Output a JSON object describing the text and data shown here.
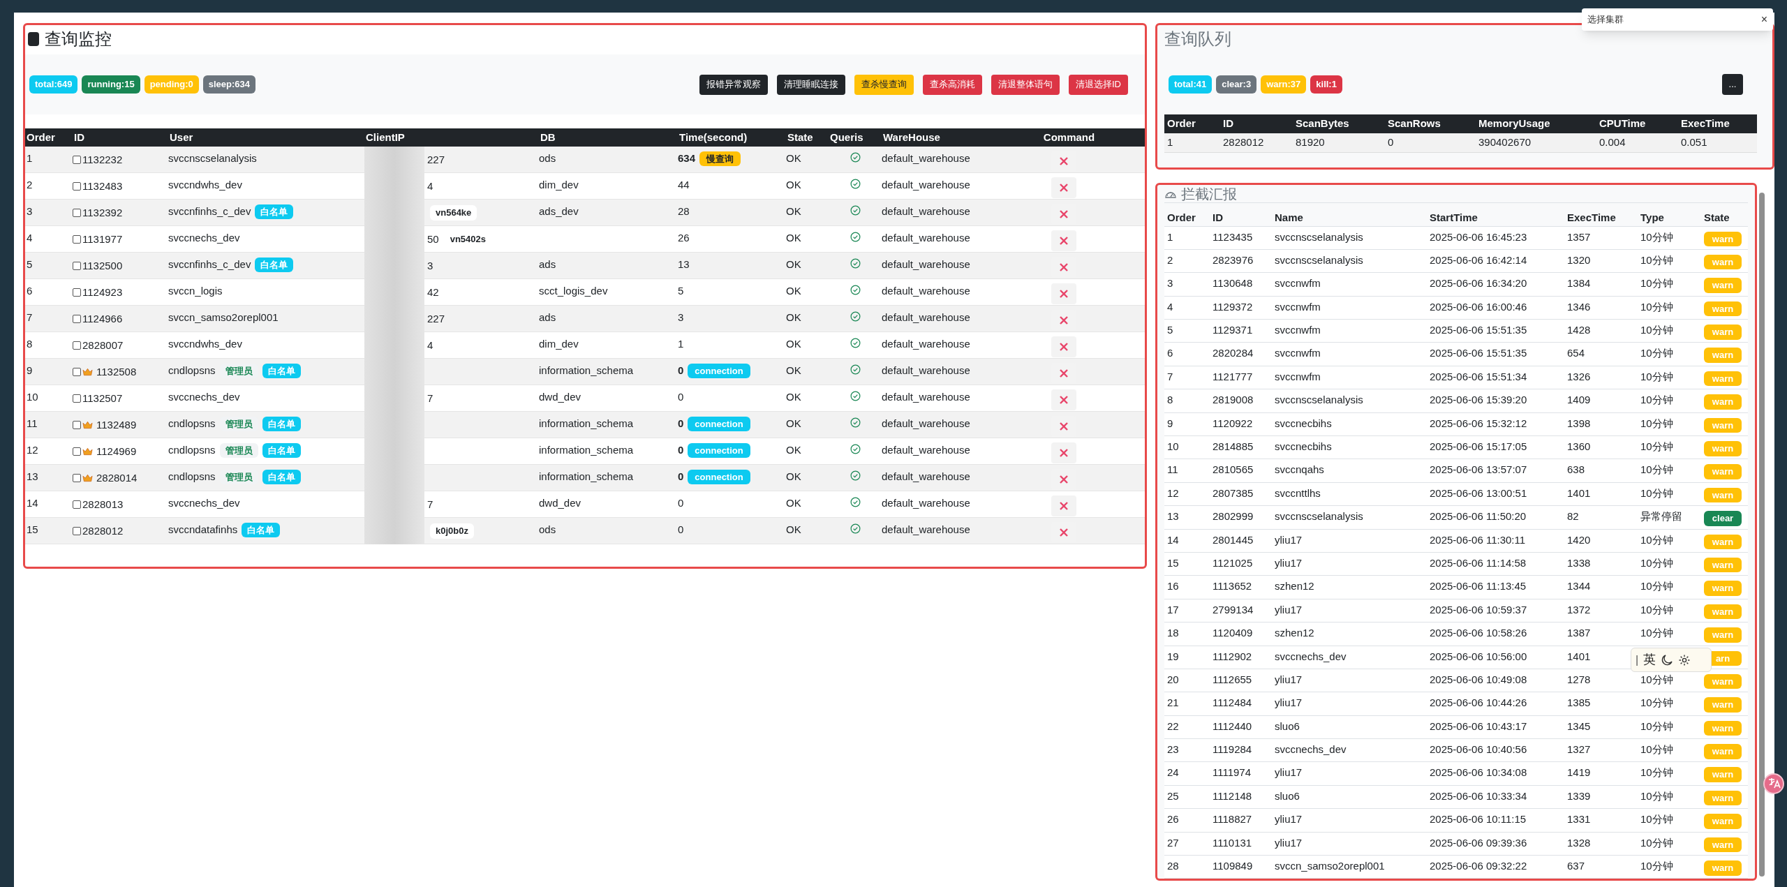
{
  "monitor": {
    "title": "查询监控",
    "counters": [
      {
        "label": "total:649",
        "color": "#0dcaf0"
      },
      {
        "label": "running:15",
        "color": "#198754"
      },
      {
        "label": "pending:0",
        "color": "#ffc107"
      },
      {
        "label": "sleep:634",
        "color": "#6c757d"
      }
    ],
    "actions": [
      {
        "label": "报错异常观察",
        "kind": "dark"
      },
      {
        "label": "清理睡眠连接",
        "kind": "dark"
      },
      {
        "label": "查杀慢查询",
        "kind": "warning"
      },
      {
        "label": "查杀高消耗",
        "kind": "danger"
      },
      {
        "label": "清退整体语句",
        "kind": "danger"
      },
      {
        "label": "清退选择ID",
        "kind": "danger"
      }
    ],
    "columns": [
      "Order",
      "ID",
      "User",
      "ClientIP",
      "DB",
      "Time(second)",
      "State",
      "Queris",
      "WareHouse",
      "Command"
    ],
    "rows": [
      {
        "order": "1",
        "id": "1132232",
        "checked": false,
        "admin": false,
        "user": "svccnscselanalysis",
        "tags": [],
        "ip_tail": "227",
        "db": "ods",
        "time": "634",
        "time_tag": {
          "kind": "slow",
          "label": "慢查询"
        },
        "state": "OK",
        "warehouse": "default_warehouse"
      },
      {
        "order": "2",
        "id": "1132483",
        "checked": false,
        "admin": false,
        "user": "svccndwhs_dev",
        "tags": [],
        "ip_tail": "4",
        "db": "dim_dev",
        "time": "44",
        "state": "OK",
        "warehouse": "default_warehouse"
      },
      {
        "order": "3",
        "id": "1132392",
        "checked": false,
        "admin": false,
        "user": "svccnfinhs_c_dev",
        "tags": [
          {
            "kind": "whitelist",
            "label": "白名单"
          }
        ],
        "host": "vn564ke",
        "db": "ads_dev",
        "time": "28",
        "state": "OK",
        "warehouse": "default_warehouse"
      },
      {
        "order": "4",
        "id": "1131977",
        "checked": false,
        "admin": false,
        "user": "svccnechs_dev",
        "tags": [],
        "ip_tail": "50",
        "host": "vn5402s",
        "time": "26",
        "state": "OK",
        "warehouse": "default_warehouse"
      },
      {
        "order": "5",
        "id": "1132500",
        "checked": false,
        "admin": false,
        "user": "svccnfinhs_c_dev",
        "tags": [
          {
            "kind": "whitelist",
            "label": "白名单"
          }
        ],
        "ip_tail": "3",
        "db": "ads",
        "time": "13",
        "state": "OK",
        "warehouse": "default_warehouse"
      },
      {
        "order": "6",
        "id": "1124923",
        "checked": false,
        "admin": false,
        "user": "svccn_logis",
        "tags": [],
        "ip_tail": "42",
        "db": "scct_logis_dev",
        "time": "5",
        "state": "OK",
        "warehouse": "default_warehouse"
      },
      {
        "order": "7",
        "id": "1124966",
        "checked": false,
        "admin": false,
        "user": "svccn_samso2orepl001",
        "tags": [],
        "ip_tail": "227",
        "db": "ads",
        "time": "3",
        "state": "OK",
        "warehouse": "default_warehouse"
      },
      {
        "order": "8",
        "id": "2828007",
        "checked": false,
        "admin": false,
        "user": "svccndwhs_dev",
        "tags": [],
        "ip_tail": "4",
        "db": "dim_dev",
        "time": "1",
        "state": "OK",
        "warehouse": "default_warehouse"
      },
      {
        "order": "9",
        "id": "1132508",
        "checked": false,
        "admin": true,
        "user": "cndlopsns",
        "tags": [
          {
            "kind": "admin",
            "label": "管理员"
          },
          {
            "kind": "whitelist",
            "label": "白名单"
          }
        ],
        "db": "information_schema",
        "time": "0",
        "time_tag": {
          "kind": "connection",
          "label": "connection"
        },
        "state": "OK",
        "warehouse": "default_warehouse"
      },
      {
        "order": "10",
        "id": "1132507",
        "checked": false,
        "admin": false,
        "user": "svccnechs_dev",
        "tags": [],
        "ip_tail": "7",
        "db": "dwd_dev",
        "time": "0",
        "state": "OK",
        "warehouse": "default_warehouse"
      },
      {
        "order": "11",
        "id": "1132489",
        "checked": false,
        "admin": true,
        "user": "cndlopsns",
        "tags": [
          {
            "kind": "admin",
            "label": "管理员"
          },
          {
            "kind": "whitelist",
            "label": "白名单"
          }
        ],
        "db": "information_schema",
        "time": "0",
        "time_tag": {
          "kind": "connection",
          "label": "connection"
        },
        "state": "OK",
        "warehouse": "default_warehouse"
      },
      {
        "order": "12",
        "id": "1124969",
        "checked": false,
        "admin": true,
        "user": "cndlopsns",
        "tags": [
          {
            "kind": "admin",
            "label": "管理员"
          },
          {
            "kind": "whitelist",
            "label": "白名单"
          }
        ],
        "db": "information_schema",
        "time": "0",
        "time_tag": {
          "kind": "connection",
          "label": "connection"
        },
        "state": "OK",
        "warehouse": "default_warehouse"
      },
      {
        "order": "13",
        "id": "2828014",
        "checked": false,
        "admin": true,
        "user": "cndlopsns",
        "tags": [
          {
            "kind": "admin",
            "label": "管理员"
          },
          {
            "kind": "whitelist",
            "label": "白名单"
          }
        ],
        "db": "information_schema",
        "time": "0",
        "time_tag": {
          "kind": "connection",
          "label": "connection"
        },
        "state": "OK",
        "warehouse": "default_warehouse"
      },
      {
        "order": "14",
        "id": "2828013",
        "checked": false,
        "admin": false,
        "user": "svccnechs_dev",
        "tags": [],
        "ip_tail": "7",
        "db": "dwd_dev",
        "time": "0",
        "state": "OK",
        "warehouse": "default_warehouse"
      },
      {
        "order": "15",
        "id": "2828012",
        "checked": false,
        "admin": false,
        "user": "svccndatafinhs",
        "tags": [
          {
            "kind": "whitelist",
            "label": "白名单"
          }
        ],
        "host": "k0j0b0z",
        "db": "ods",
        "time": "0",
        "state": "OK",
        "warehouse": "default_warehouse"
      }
    ]
  },
  "queue": {
    "title": "查询队列",
    "counters": [
      {
        "label": "total:41",
        "color": "#0dcaf0"
      },
      {
        "label": "clear:3",
        "color": "#6c757d"
      },
      {
        "label": "warn:37",
        "color": "#ffc107"
      },
      {
        "label": "kill:1",
        "color": "#dc3545"
      }
    ],
    "more_button": "...",
    "columns": [
      "Order",
      "ID",
      "ScanBytes",
      "ScanRows",
      "MemoryUsage",
      "CPUTime",
      "ExecTime"
    ],
    "rows": [
      [
        "1",
        "2828012",
        "81920",
        "0",
        "390402670",
        "0.004",
        "0.051"
      ]
    ]
  },
  "report": {
    "title": "拦截汇报",
    "columns": [
      "Order",
      "ID",
      "Name",
      "StartTime",
      "ExecTime",
      "Type",
      "State"
    ],
    "rows": [
      {
        "cells": [
          "1",
          "1123435",
          "svccnscselanalysis",
          "2025-06-06 16:45:23",
          "1357",
          "10分钟"
        ],
        "state": "warn",
        "color": "#ffc107"
      },
      {
        "cells": [
          "2",
          "2823976",
          "svccnscselanalysis",
          "2025-06-06 16:42:14",
          "1320",
          "10分钟"
        ],
        "state": "warn",
        "color": "#ffc107"
      },
      {
        "cells": [
          "3",
          "1130648",
          "svccnwfm",
          "2025-06-06 16:34:20",
          "1384",
          "10分钟"
        ],
        "state": "warn",
        "color": "#ffc107"
      },
      {
        "cells": [
          "4",
          "1129372",
          "svccnwfm",
          "2025-06-06 16:00:46",
          "1346",
          "10分钟"
        ],
        "state": "warn",
        "color": "#ffc107"
      },
      {
        "cells": [
          "5",
          "1129371",
          "svccnwfm",
          "2025-06-06 15:51:35",
          "1428",
          "10分钟"
        ],
        "state": "warn",
        "color": "#ffc107"
      },
      {
        "cells": [
          "6",
          "2820284",
          "svccnwfm",
          "2025-06-06 15:51:35",
          "654",
          "10分钟"
        ],
        "state": "warn",
        "color": "#ffc107"
      },
      {
        "cells": [
          "7",
          "1121777",
          "svccnwfm",
          "2025-06-06 15:51:34",
          "1326",
          "10分钟"
        ],
        "state": "warn",
        "color": "#ffc107"
      },
      {
        "cells": [
          "8",
          "2819008",
          "svccnscselanalysis",
          "2025-06-06 15:39:20",
          "1409",
          "10分钟"
        ],
        "state": "warn",
        "color": "#ffc107"
      },
      {
        "cells": [
          "9",
          "1120922",
          "svccnecbihs",
          "2025-06-06 15:32:12",
          "1398",
          "10分钟"
        ],
        "state": "warn",
        "color": "#ffc107"
      },
      {
        "cells": [
          "10",
          "2814885",
          "svccnecbihs",
          "2025-06-06 15:17:05",
          "1360",
          "10分钟"
        ],
        "state": "warn",
        "color": "#ffc107"
      },
      {
        "cells": [
          "11",
          "2810565",
          "svccnqahs",
          "2025-06-06 13:57:07",
          "638",
          "10分钟"
        ],
        "state": "warn",
        "color": "#ffc107"
      },
      {
        "cells": [
          "12",
          "2807385",
          "svccnttlhs",
          "2025-06-06 13:00:51",
          "1401",
          "10分钟"
        ],
        "state": "warn",
        "color": "#ffc107"
      },
      {
        "cells": [
          "13",
          "2802999",
          "svccnscselanalysis",
          "2025-06-06 11:50:20",
          "82",
          "异常停留"
        ],
        "state": "clear",
        "color": "#198754"
      },
      {
        "cells": [
          "14",
          "2801445",
          "yliu17",
          "2025-06-06 11:30:11",
          "1420",
          "10分钟"
        ],
        "state": "warn",
        "color": "#ffc107"
      },
      {
        "cells": [
          "15",
          "1121025",
          "yliu17",
          "2025-06-06 11:14:58",
          "1338",
          "10分钟"
        ],
        "state": "warn",
        "color": "#ffc107"
      },
      {
        "cells": [
          "16",
          "1113652",
          "szhen12",
          "2025-06-06 11:13:45",
          "1344",
          "10分钟"
        ],
        "state": "warn",
        "color": "#ffc107"
      },
      {
        "cells": [
          "17",
          "2799134",
          "yliu17",
          "2025-06-06 10:59:37",
          "1372",
          "10分钟"
        ],
        "state": "warn",
        "color": "#ffc107"
      },
      {
        "cells": [
          "18",
          "1120409",
          "szhen12",
          "2025-06-06 10:58:26",
          "1387",
          "10分钟"
        ],
        "state": "warn",
        "color": "#ffc107"
      },
      {
        "cells": [
          "19",
          "1112902",
          "svccnechs_dev",
          "2025-06-06 10:56:00",
          "1401"
        ],
        "state": "arn",
        "color": "#ffc107"
      },
      {
        "cells": [
          "20",
          "1112655",
          "yliu17",
          "2025-06-06 10:49:08",
          "1278",
          "10分钟"
        ],
        "state": "warn",
        "color": "#ffc107"
      },
      {
        "cells": [
          "21",
          "1112484",
          "yliu17",
          "2025-06-06 10:44:26",
          "1385",
          "10分钟"
        ],
        "state": "warn",
        "color": "#ffc107"
      },
      {
        "cells": [
          "22",
          "1112440",
          "sluo6",
          "2025-06-06 10:43:17",
          "1345",
          "10分钟"
        ],
        "state": "warn",
        "color": "#ffc107"
      },
      {
        "cells": [
          "23",
          "1119284",
          "svccnechs_dev",
          "2025-06-06 10:40:56",
          "1327",
          "10分钟"
        ],
        "state": "warn",
        "color": "#ffc107"
      },
      {
        "cells": [
          "24",
          "1111974",
          "yliu17",
          "2025-06-06 10:34:08",
          "1419",
          "10分钟"
        ],
        "state": "warn",
        "color": "#ffc107"
      },
      {
        "cells": [
          "25",
          "1112148",
          "sluo6",
          "2025-06-06 10:33:34",
          "1339",
          "10分钟"
        ],
        "state": "warn",
        "color": "#ffc107"
      },
      {
        "cells": [
          "26",
          "1118827",
          "yliu17",
          "2025-06-06 10:11:15",
          "1331",
          "10分钟"
        ],
        "state": "warn",
        "color": "#ffc107"
      },
      {
        "cells": [
          "27",
          "1110131",
          "yliu17",
          "2025-06-06 09:39:36",
          "1328",
          "10分钟"
        ],
        "state": "warn",
        "color": "#ffc107"
      },
      {
        "cells": [
          "28",
          "1109849",
          "svccn_samso2orepl001",
          "2025-06-06 09:32:22",
          "637",
          "10分钟"
        ],
        "state": "warn",
        "color": "#ffc107"
      }
    ]
  },
  "cluster_popup": {
    "label": "选择集群",
    "close": "×"
  },
  "ime_bar": {
    "separator": "|",
    "label": "英"
  }
}
